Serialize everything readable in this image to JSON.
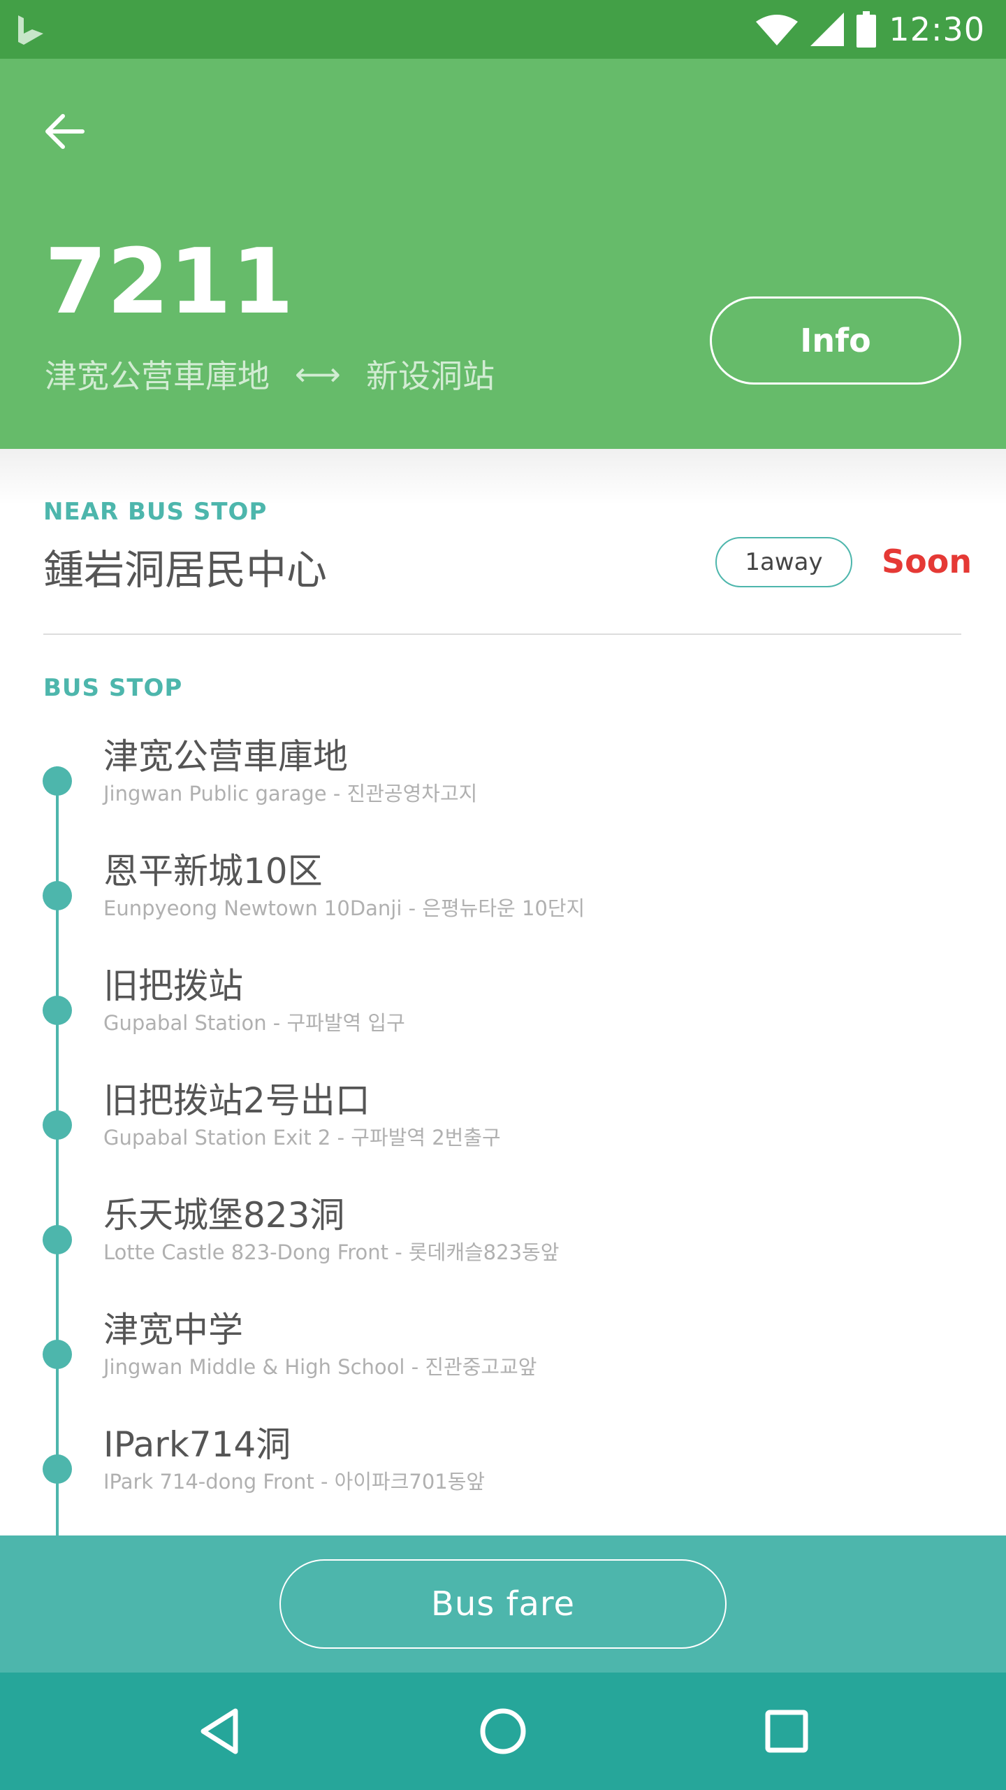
{
  "status_bar": {
    "time": "12:30",
    "icons": [
      "app-logo-icon",
      "wifi-icon",
      "cell-signal-icon",
      "battery-icon"
    ]
  },
  "header": {
    "route_number": "7211",
    "origin": "津宽公营車庫地",
    "arrow": "⟷",
    "destination": "新设洞站",
    "info_label": "Info",
    "colors": {
      "header": "#66bb6a",
      "status": "#43a047"
    }
  },
  "near": {
    "label": "NEAR BUS STOP",
    "stop_name": "鍾岩洞居民中心",
    "away": "1away",
    "status": "Soon",
    "status_color": "#e53935"
  },
  "stops": {
    "label": "BUS STOP",
    "items": [
      {
        "name": "津宽公营車庫地",
        "sub": "Jingwan Public garage - 진관공영차고지"
      },
      {
        "name": "恩平新城10区",
        "sub": "Eunpyeong Newtown 10Danji - 은평뉴타운 10단지"
      },
      {
        "name": "旧把拨站",
        "sub": "Gupabal Station - 구파발역 입구"
      },
      {
        "name": "旧把拨站2号出口",
        "sub": "Gupabal Station Exit 2 - 구파발역 2번출구"
      },
      {
        "name": "乐天城堡823洞",
        "sub": "Lotte Castle 823-Dong Front - 롯데캐슬823동앞"
      },
      {
        "name": "津宽中学",
        "sub": "Jingwan Middle & High School - 진관중고교앞"
      },
      {
        "name": "IPark714洞",
        "sub": "IPark 714-dong Front - 아이파크701동앞"
      }
    ],
    "accent": "#4db6ac"
  },
  "footer": {
    "fare_label": "Bus fare"
  },
  "nav": {
    "icons": [
      "back-icon",
      "home-icon",
      "recents-icon"
    ]
  }
}
